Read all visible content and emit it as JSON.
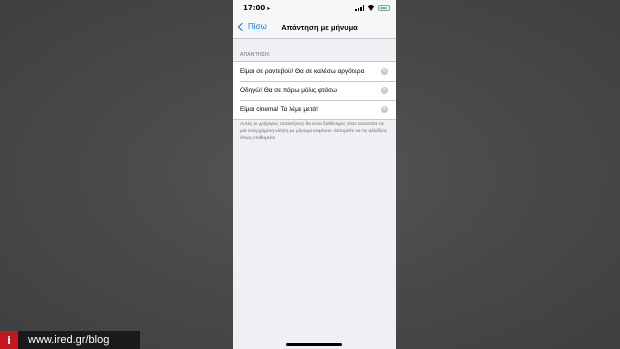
{
  "status_bar": {
    "time": "17:00",
    "location_icon": "location-arrow-icon"
  },
  "nav": {
    "back_label": "Πίσω",
    "title": "Απάντηση με μήνυμα"
  },
  "section": {
    "header": "ΑΠΑΝΤΗΣΗ:"
  },
  "responses": [
    {
      "text": "Είμαι σε ραντεβού! Θα σε καλέσω αργότερα"
    },
    {
      "text": "Οδηγώ! Θα σε πάρω μόλις φτάσω"
    },
    {
      "text": "Είμαι cinema! Τα λέμε μετά!"
    }
  ],
  "footer": {
    "text": "Αυτές οι γρήγορες απαντήσεις θα είναι διαθέσιμες όταν απαντάτε σε μια εισερχόμενη κλήση με μήνυμα κειμένου. Μπορείτε να τις αλλάξετε όπως επιθυμείτε."
  },
  "watermark": {
    "logo": "i",
    "text": "www.ired.gr/blog"
  },
  "colors": {
    "accent": "#007aff",
    "background": "#efeff4",
    "watermark_red": "#c4161c"
  }
}
